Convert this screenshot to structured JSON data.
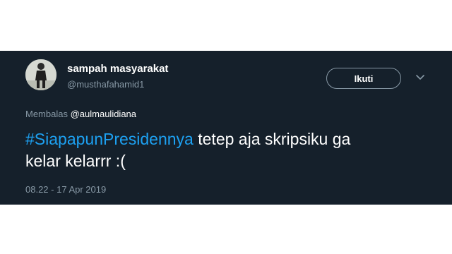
{
  "tweet": {
    "display_name": "sampah masyarakat",
    "handle": "@musthafahamid1",
    "follow_label": "Ikuti",
    "reply_prefix": "Membalas",
    "reply_mention": "@aulmaulidiana",
    "hashtag": "#SiapapunPresidennya",
    "text_line1_rest": " tetep aja skripsiku ga",
    "text_line2": "kelar kelarrr :(",
    "timestamp": "08.22 - 17 Apr 2019"
  },
  "icons": {
    "more": "chevron-down-icon",
    "avatar": "avatar-photo"
  },
  "colors": {
    "background": "#15202b",
    "hashtag": "#1da1f2",
    "secondary_text": "#8899a6",
    "primary_text": "#ffffff"
  }
}
